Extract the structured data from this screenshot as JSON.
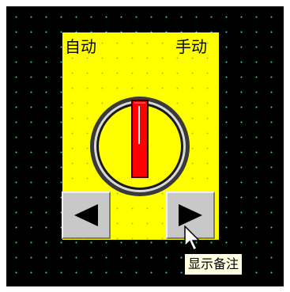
{
  "switch": {
    "left_label": "自动",
    "right_label": "手动",
    "knob_color": "#ff0000",
    "panel_color": "#ffff00"
  },
  "controls": {
    "left_icon": "triangle-left-icon",
    "right_icon": "triangle-right-icon"
  },
  "tooltip": {
    "text": "显示备注"
  },
  "colors": {
    "background": "#000000",
    "grid_dots": "#2ec4c4",
    "button_face": "#c8c8c8",
    "tooltip_bg": "#ffffe1"
  }
}
